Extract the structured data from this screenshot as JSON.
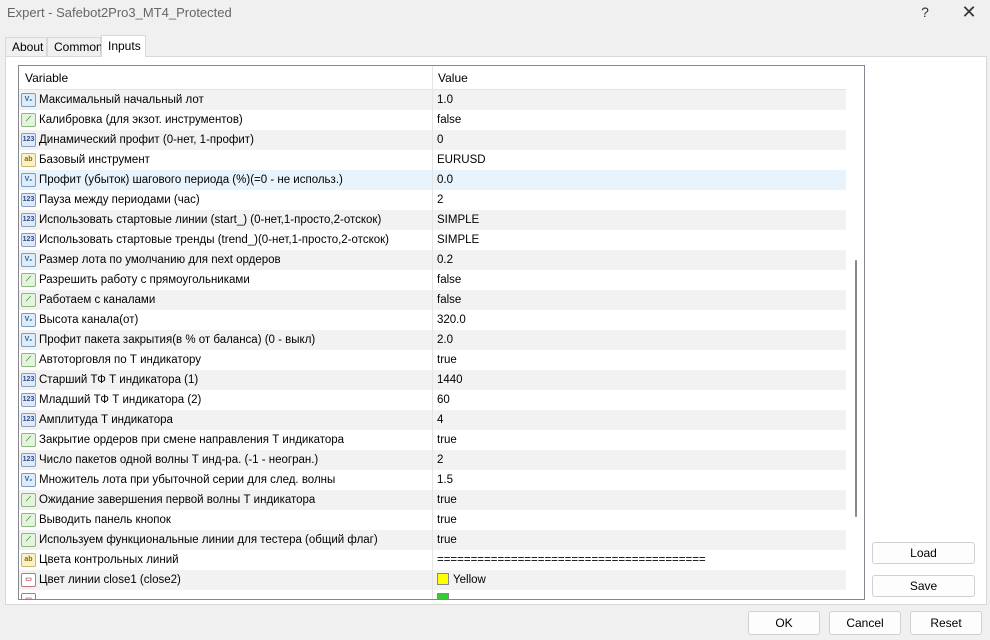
{
  "window": {
    "title": "Expert - Safebot2Pro3_MT4_Protected",
    "help": "?",
    "close": "✕"
  },
  "tabs": [
    {
      "label": "About",
      "active": false
    },
    {
      "label": "Common",
      "active": false
    },
    {
      "label": "Inputs",
      "active": true
    }
  ],
  "grid": {
    "headers": {
      "variable": "Variable",
      "value": "Value"
    },
    "rows": [
      {
        "icon": "double-icon",
        "icon_text": "V₂",
        "variable": "Максимальный начальный лот",
        "value": "1.0"
      },
      {
        "icon": "bool-icon",
        "icon_text": "⟋",
        "variable": "Калибровка (для экзот. инструментов)",
        "value": "false"
      },
      {
        "icon": "int-icon",
        "icon_text": "123",
        "variable": "Динамический профит (0-нет, 1-профит)",
        "value": "0"
      },
      {
        "icon": "string-icon",
        "icon_text": "ab",
        "variable": "Базовый инструмент",
        "value": "EURUSD"
      },
      {
        "icon": "double-icon",
        "icon_text": "V₂",
        "variable": "Профит (убыток) шагового периода (%)(=0 - не использ.)",
        "value": "0.0"
      },
      {
        "icon": "int-icon",
        "icon_text": "123",
        "variable": "Пауза между периодами (час)",
        "value": "2"
      },
      {
        "icon": "int-icon",
        "icon_text": "123",
        "variable": "Использовать стартовые линии (start_) (0-нет,1-просто,2-отскок)",
        "value": "SIMPLE"
      },
      {
        "icon": "int-icon",
        "icon_text": "123",
        "variable": "Использовать стартовые тренды (trend_)(0-нет,1-просто,2-отскок)",
        "value": "SIMPLE"
      },
      {
        "icon": "double-icon",
        "icon_text": "V₂",
        "variable": "Размер лота по умолчанию для next ордеров",
        "value": "0.2"
      },
      {
        "icon": "bool-icon",
        "icon_text": "⟋",
        "variable": "Разрешить работу с прямоугольниками",
        "value": "false"
      },
      {
        "icon": "bool-icon",
        "icon_text": "⟋",
        "variable": "Работаем с каналами",
        "value": "false"
      },
      {
        "icon": "double-icon",
        "icon_text": "V₂",
        "variable": "Высота канала(от)",
        "value": "320.0"
      },
      {
        "icon": "double-icon",
        "icon_text": "V₂",
        "variable": "Профит пакета закрытия(в % от баланса) (0 - выкл)",
        "value": "2.0"
      },
      {
        "icon": "bool-icon",
        "icon_text": "⟋",
        "variable": "Автоторговля по Т индикатору",
        "value": "true"
      },
      {
        "icon": "int-icon",
        "icon_text": "123",
        "variable": "Старший ТФ Т индикатора (1)",
        "value": "1440"
      },
      {
        "icon": "int-icon",
        "icon_text": "123",
        "variable": "Младший ТФ Т индикатора (2)",
        "value": "60"
      },
      {
        "icon": "int-icon",
        "icon_text": "123",
        "variable": "Амплитуда Т индикатора",
        "value": "4"
      },
      {
        "icon": "bool-icon",
        "icon_text": "⟋",
        "variable": "Закрытие ордеров при смене направления Т индикатора",
        "value": "true"
      },
      {
        "icon": "int-icon",
        "icon_text": "123",
        "variable": "Число пакетов одной волны Т инд-ра. (-1 - неогран.)",
        "value": "2"
      },
      {
        "icon": "double-icon",
        "icon_text": "V₂",
        "variable": "Множитель лота при убыточной серии для след. волны",
        "value": "1.5"
      },
      {
        "icon": "bool-icon",
        "icon_text": "⟋",
        "variable": "Ожидание завершения первой волны Т индикатора",
        "value": "true"
      },
      {
        "icon": "bool-icon",
        "icon_text": "⟋",
        "variable": "Выводить панель кнопок",
        "value": "true"
      },
      {
        "icon": "bool-icon",
        "icon_text": "⟋",
        "variable": "Используем функциональные линии для тестера (общий флаг)",
        "value": "true"
      },
      {
        "icon": "string-icon",
        "icon_text": "ab",
        "variable": "Цвета контрольных линий",
        "value": "========================================"
      },
      {
        "icon": "color-icon",
        "icon_text": "▭",
        "variable": "Цвет линии close1 (close2)",
        "value": "Yellow",
        "swatch": "#ffff00"
      },
      {
        "icon": "color-icon",
        "icon_text": "▭",
        "variable": "",
        "value": "",
        "swatch": "#33cc33"
      }
    ]
  },
  "buttons": {
    "load": "Load",
    "save": "Save",
    "ok": "OK",
    "cancel": "Cancel",
    "reset": "Reset"
  },
  "colors": {
    "selected_row": "#e9f3fb",
    "alt_row": "#f2f2f2",
    "border": "#828790"
  }
}
